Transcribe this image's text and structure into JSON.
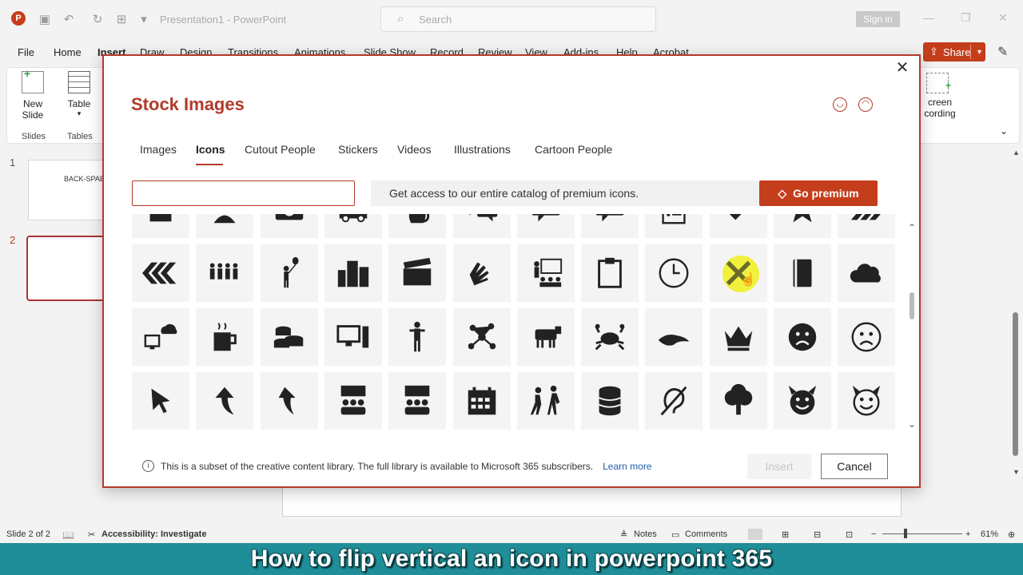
{
  "app": {
    "logo_letter": "P",
    "window_title": "Presentation1 - PowerPoint",
    "search_placeholder": "Search",
    "sign_in": "Sign in"
  },
  "ribbon_tabs": [
    "File",
    "Home",
    "Insert",
    "Draw",
    "Design",
    "Transitions",
    "Animations",
    "Slide Show",
    "Record",
    "Review",
    "View",
    "Add-ins",
    "Help",
    "Acrobat"
  ],
  "share_label": "Share",
  "ribbon": {
    "new_slide": "New",
    "new_slide_2": "Slide",
    "table": "Table",
    "group_slides": "Slides",
    "group_tables": "Tables",
    "screen_recording_1": "creen",
    "screen_recording_2": "cording"
  },
  "slides": [
    {
      "number": "1",
      "title": "BACK-SPAE"
    },
    {
      "number": "2",
      "title": ""
    }
  ],
  "dialog": {
    "title": "Stock Images",
    "tabs": [
      "Images",
      "Icons",
      "Cutout People",
      "Stickers",
      "Videos",
      "Illustrations",
      "Cartoon People"
    ],
    "active_tab": "Icons",
    "search_value": "",
    "premium_text": "Get access to our entire catalog of premium icons.",
    "go_premium": "Go premium",
    "footer_text": "This is a subset of the creative content library. The full library is available to Microsoft 365 subscribers.",
    "learn_more": "Learn more",
    "insert": "Insert",
    "cancel": "Cancel",
    "icons": [
      "birthday-cake",
      "person-headset",
      "camera",
      "car",
      "cat",
      "chat-bubbles",
      "comment-dots",
      "comment-dots-2",
      "checklist",
      "checkmark",
      "hands-star",
      "chevrons-right",
      "chevrons-left",
      "group-people",
      "person-balloon",
      "city-buildings",
      "clapperboard",
      "clapping-hands",
      "classroom-teacher",
      "clipboard",
      "clock",
      "close-x",
      "notebook",
      "cloud",
      "cloud-computer",
      "coffee-mug",
      "coins",
      "computer-desktop",
      "person-standing",
      "molecule",
      "cow",
      "crab",
      "crocodile",
      "crown",
      "sad-face-filled",
      "sad-face-outline",
      "cursor-arrow",
      "curved-arrow-up",
      "curved-arrow-left",
      "presentation-meeting",
      "presentation-meeting-2",
      "calendar",
      "dancing-couple",
      "database",
      "ear-deaf",
      "tree",
      "devil-face-filled",
      "devil-face-outline"
    ],
    "hovered_icon": "close-x"
  },
  "status": {
    "slide_info": "Slide 2 of 2",
    "accessibility": "Accessibility: Investigate",
    "notes": "Notes",
    "comments": "Comments",
    "zoom": "61%"
  },
  "caption": "How to flip vertical an icon in powerpoint 365"
}
